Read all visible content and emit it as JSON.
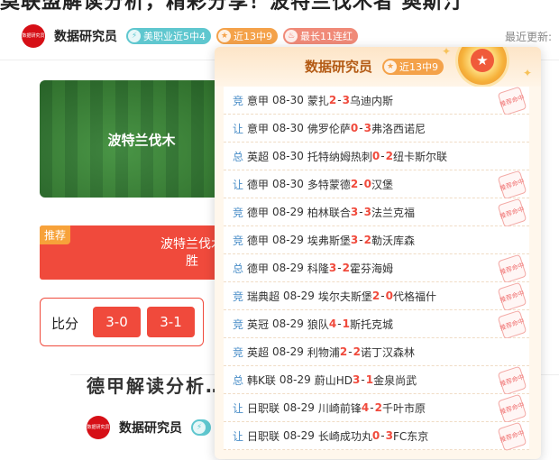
{
  "header": {
    "title": "莫联盟解读分析，精彩分享！波特兰伐木者 奥斯汀",
    "author": "数据研究员",
    "avatar_text": "数据研究员",
    "chips": [
      {
        "label": "美职业近5中4",
        "icon": "lightning-icon",
        "color": "#5fc7cf"
      },
      {
        "label": "近13中9",
        "icon": "star-icon",
        "color": "#f4a24a"
      },
      {
        "label": "最长11连红",
        "icon": "flame-icon",
        "color": "#f08a78"
      }
    ],
    "last_update": "最近更新:"
  },
  "article": {
    "image_text": "波特兰伐木",
    "recommend_badge": "推荐",
    "recommend_text": "波特兰伐木\n胜",
    "score_label": "比分",
    "scores": [
      "3-0",
      "3-1"
    ],
    "second_title": "德甲解读分析…精彩分…",
    "second_author": "数据研究员"
  },
  "popup": {
    "title": "数据研究员",
    "chip": "近13中9",
    "stamp_text": "推荐命中",
    "matches": [
      {
        "type": "竞",
        "league": "意甲",
        "date": "08-30",
        "home": "蒙扎",
        "hs": "2",
        "as": "3",
        "away": "乌迪内斯",
        "hit": true
      },
      {
        "type": "让",
        "league": "意甲",
        "date": "08-30",
        "home": "佛罗伦萨",
        "hs": "0",
        "as": "3",
        "away": "弗洛西诺尼",
        "hit": false
      },
      {
        "type": "总",
        "league": "英超",
        "date": "08-30",
        "home": "托特纳姆热刺",
        "hs": "0",
        "as": "2",
        "away": "纽卡斯尔联",
        "hit": false
      },
      {
        "type": "让",
        "league": "德甲",
        "date": "08-30",
        "home": "多特蒙德",
        "hs": "2",
        "as": "0",
        "away": "汉堡",
        "hit": true
      },
      {
        "type": "竞",
        "league": "德甲",
        "date": "08-29",
        "home": "柏林联合",
        "hs": "3",
        "as": "3",
        "away": "法兰克福",
        "hit": true
      },
      {
        "type": "竞",
        "league": "德甲",
        "date": "08-29",
        "home": "埃弗斯堡",
        "hs": "3",
        "as": "2",
        "away": "勒沃库森",
        "hit": false
      },
      {
        "type": "总",
        "league": "德甲",
        "date": "08-29",
        "home": "科隆",
        "hs": "3",
        "as": "2",
        "away": "霍芬海姆",
        "hit": true
      },
      {
        "type": "竞",
        "league": "瑞典超",
        "date": "08-29",
        "home": "埃尔夫斯堡",
        "hs": "2",
        "as": "0",
        "away": "代格福什",
        "hit": true
      },
      {
        "type": "竞",
        "league": "英冠",
        "date": "08-29",
        "home": "狼队",
        "hs": "4",
        "as": "1",
        "away": "斯托克城",
        "hit": true
      },
      {
        "type": "竞",
        "league": "英超",
        "date": "08-29",
        "home": "利物浦",
        "hs": "2",
        "as": "2",
        "away": "诺丁汉森林",
        "hit": false
      },
      {
        "type": "总",
        "league": "韩K联",
        "date": "08-29",
        "home": "蔚山HD",
        "hs": "3",
        "as": "1",
        "away": "金泉尚武",
        "hit": true
      },
      {
        "type": "让",
        "league": "日职联",
        "date": "08-29",
        "home": "川崎前锋",
        "hs": "4",
        "as": "2",
        "away": "千叶市原",
        "hit": true
      },
      {
        "type": "让",
        "league": "日职联",
        "date": "08-29",
        "home": "长崎成功丸",
        "hs": "0",
        "as": "3",
        "away": "FC东京",
        "hit": true
      }
    ]
  }
}
